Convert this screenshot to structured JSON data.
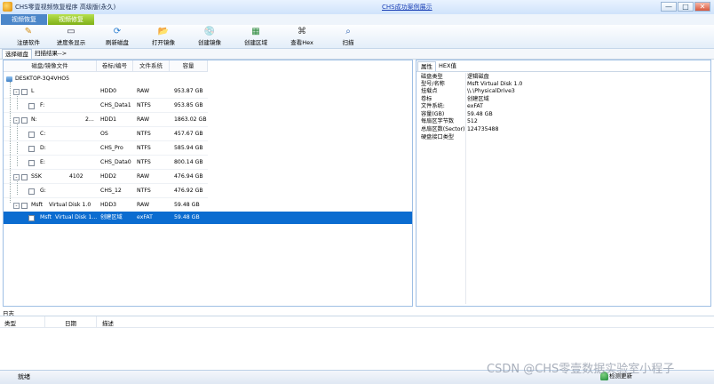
{
  "window": {
    "title": "CHS零壹视频恢复程序 高级版(永久)",
    "link": "CHS成功案例展示",
    "min": "—",
    "max": "□",
    "close": "✕"
  },
  "mode_tabs": [
    "视频恢复",
    "视频修复"
  ],
  "toolbar": [
    {
      "label": "注册软件",
      "icon": "✎"
    },
    {
      "label": "进度条显示",
      "icon": "▭"
    },
    {
      "label": "刷新磁盘",
      "icon": "⟳"
    },
    {
      "label": "打开镜像",
      "icon": "📂"
    },
    {
      "label": "创建镜像",
      "icon": "💿"
    },
    {
      "label": "创建区域",
      "icon": "▦"
    },
    {
      "label": "查看Hex",
      "icon": "⌘"
    },
    {
      "label": "扫描",
      "icon": "⌕"
    }
  ],
  "view_tabs": [
    "选择磁盘",
    "扫描结果-->"
  ],
  "disk_table": {
    "columns": [
      "磁盘/镜像文件",
      "卷标/编号",
      "文件系统",
      "容量"
    ],
    "root": "DESKTOP-3Q4VHO5",
    "rows": [
      {
        "name": "L",
        "label": "HDD0",
        "fs": "RAW",
        "size": "953.87 GB",
        "level": 1
      },
      {
        "name": "F:",
        "label": "CHS_Data1",
        "fs": "NTFS",
        "size": "953.85 GB",
        "level": 2
      },
      {
        "name": "N:",
        "extra": "2...",
        "label": "HDD1",
        "fs": "RAW",
        "size": "1863.02 GB",
        "level": 1
      },
      {
        "name": "C:",
        "label": "OS",
        "fs": "NTFS",
        "size": "457.67 GB",
        "level": 2
      },
      {
        "name": "D:",
        "label": "CHS_Pro",
        "fs": "NTFS",
        "size": "585.94 GB",
        "level": 2
      },
      {
        "name": "E:",
        "label": "CHS_Data0",
        "fs": "NTFS",
        "size": "800.14 GB",
        "level": 2
      },
      {
        "name": "SSK",
        "extra": "4102",
        "label": "HDD2",
        "fs": "RAW",
        "size": "476.94 GB",
        "level": 1
      },
      {
        "name": "G:",
        "label": "CHS_12",
        "fs": "NTFS",
        "size": "476.92 GB",
        "level": 2
      },
      {
        "name": "Msft",
        "extra": "Virtual Disk   1.0",
        "label": "HDD3",
        "fs": "RAW",
        "size": "59.48 GB",
        "level": 1
      },
      {
        "name": "Msft",
        "extra": "Virtual Disk   1...",
        "label": "创建区域",
        "fs": "exFAT",
        "size": "59.48 GB",
        "level": 2,
        "selected": true
      }
    ]
  },
  "props_tabs": [
    "属性",
    "HEX值"
  ],
  "properties": [
    {
      "name": "磁盘类型",
      "value": "逻辑磁盘"
    },
    {
      "name": "型号/名称",
      "value": "Msft     Virtual Disk     1.0"
    },
    {
      "name": "挂载点",
      "value": "\\\\.\\PhysicalDrive3"
    },
    {
      "name": "卷标",
      "value": "创建区域"
    },
    {
      "name": "文件系统:",
      "value": "exFAT"
    },
    {
      "name": "容量(GB)",
      "value": "59.48 GB"
    },
    {
      "name": "每扇区字节数",
      "value": "512"
    },
    {
      "name": "总扇区数(Sector)",
      "value": "124735488"
    },
    {
      "name": "硬盘接口类型",
      "value": ""
    }
  ],
  "log": {
    "label": "日志",
    "columns": [
      "类型",
      "日期",
      "描述"
    ]
  },
  "status": {
    "text": "就绪",
    "update": "检测更新"
  },
  "watermark": "CSDN @CHS零壹数据实验室小程子"
}
